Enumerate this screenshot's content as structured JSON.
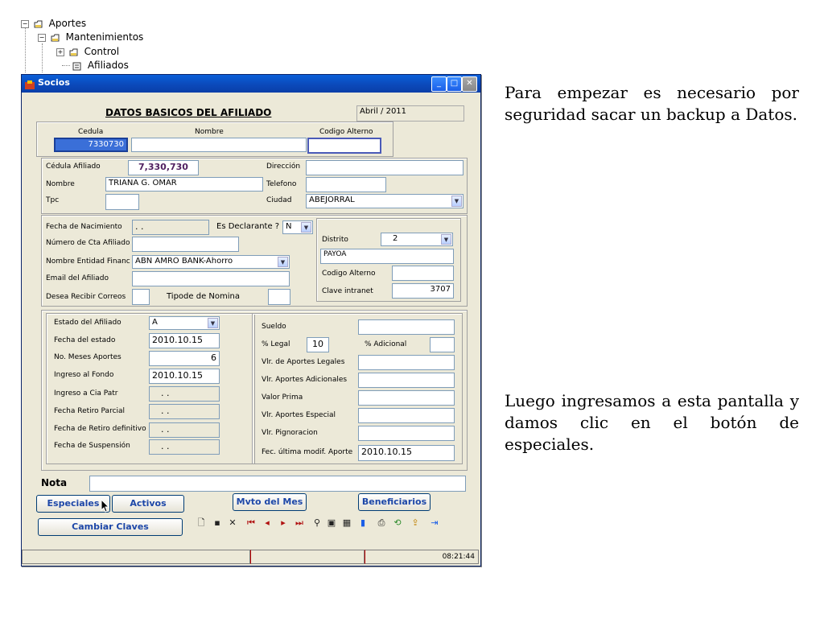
{
  "tree": {
    "n1": "Aportes",
    "n2": "Mantenimientos",
    "n3": "Control",
    "n4": "Afiliados"
  },
  "window": {
    "title": "Socios",
    "header": "DATOS BASICOS DEL AFILIADO",
    "period": "Abril / 2011",
    "search": {
      "cedula_label": "Cedula",
      "nombre_label": "Nombre",
      "codigo_label": "Codigo Alterno",
      "cedula_value": "7330730",
      "nombre_value": "",
      "codigo_value": ""
    },
    "basic": {
      "cedula_lbl": "Cédula Afiliado",
      "cedula_val": "7,330,730",
      "nombre_lbl": "Nombre",
      "nombre_val": "TRIANA G. OMAR",
      "tpc_lbl": "Tpc",
      "tpc_val": "",
      "direccion_lbl": "Dirección",
      "direccion_val": "",
      "telefono_lbl": "Telefono",
      "telefono_val": "",
      "ciudad_lbl": "Ciudad",
      "ciudad_val": "ABEJORRAL"
    },
    "personal": {
      "fnac_lbl": "Fecha de Nacimiento",
      "fnac_val": ". .",
      "declarante_lbl": "Es Declarante ?",
      "declarante_val": "N",
      "cta_lbl": "Número de Cta Afiliado",
      "cta_val": "",
      "entidad_lbl": "Nombre Entidad Financ",
      "entidad_val": "ABN AMRO BANK-Ahorro",
      "email_lbl": "Email del Afiliado",
      "email_val": "",
      "correos_lbl": "Desea Recibir Correos",
      "nomina_lbl": "Tipode de Nomina",
      "distrito_lbl": "Distrito",
      "distrito_val": "2",
      "distrito_name": "PAYOA",
      "cod_alt_lbl": "Codigo Alterno",
      "cod_alt_val": "",
      "clave_lbl": "Clave intranet",
      "clave_val": "3707"
    },
    "estado": {
      "estado_lbl": "Estado del Afiliado",
      "estado_val": "A",
      "fecha_estado_lbl": "Fecha del estado",
      "fecha_estado_val": "2010.10.15",
      "meses_lbl": "No. Meses Aportes",
      "meses_val": "6",
      "ingreso_lbl": "Ingreso al Fondo",
      "ingreso_val": "2010.10.15",
      "cia_lbl": "Ingreso a Cia Patr",
      "cia_val": ". .",
      "retiro_parcial_lbl": "Fecha Retiro Parcial",
      "retiro_parcial_val": ". .",
      "retiro_def_lbl": "Fecha de Retiro definitivo",
      "retiro_def_val": ". .",
      "suspension_lbl": "Fecha de Suspensión",
      "suspension_val": ". ."
    },
    "aportes": {
      "sueldo_lbl": "Sueldo",
      "sueldo_val": "",
      "legal_lbl": "% Legal",
      "legal_val": "10",
      "adicional_lbl": "% Adicional",
      "adicional_val": "",
      "vlr_legales_lbl": "Vlr. de Aportes Legales",
      "vlr_adicionales_lbl": "Vlr. Aportes Adicionales",
      "prima_lbl": "Valor Prima",
      "especial_lbl": "Vlr. Aportes Especial",
      "pignoracion_lbl": "Vlr. Pignoracion",
      "ultima_lbl": "Fec. última modif. Aporte",
      "ultima_val": "2010.10.15"
    },
    "nota_lbl": "Nota",
    "buttons": {
      "especiales": "Especiales",
      "activos": "Activos",
      "mvto": "Mvto del Mes",
      "beneficiarios": "Beneficiarios",
      "cambiar": "Cambiar Claves"
    },
    "status_time": "08:21:44"
  },
  "side_text": {
    "p1": "Para empezar es necesario por seguridad sacar un backup a Datos.",
    "p2": "Luego ingresamos a esta pantalla y damos clic en el botón de especiales."
  },
  "colors": {
    "titlebar": "#0b48b8",
    "dialog": "#ece9d8",
    "button_text": "#1d47a8"
  },
  "icons": [
    "minimize-icon",
    "maximize-icon",
    "close-icon",
    "new-icon",
    "save-icon",
    "delete-icon",
    "first-icon",
    "prev-icon",
    "next-icon",
    "last-icon",
    "find-icon",
    "print-icon",
    "chart-icon",
    "exit-icon"
  ]
}
